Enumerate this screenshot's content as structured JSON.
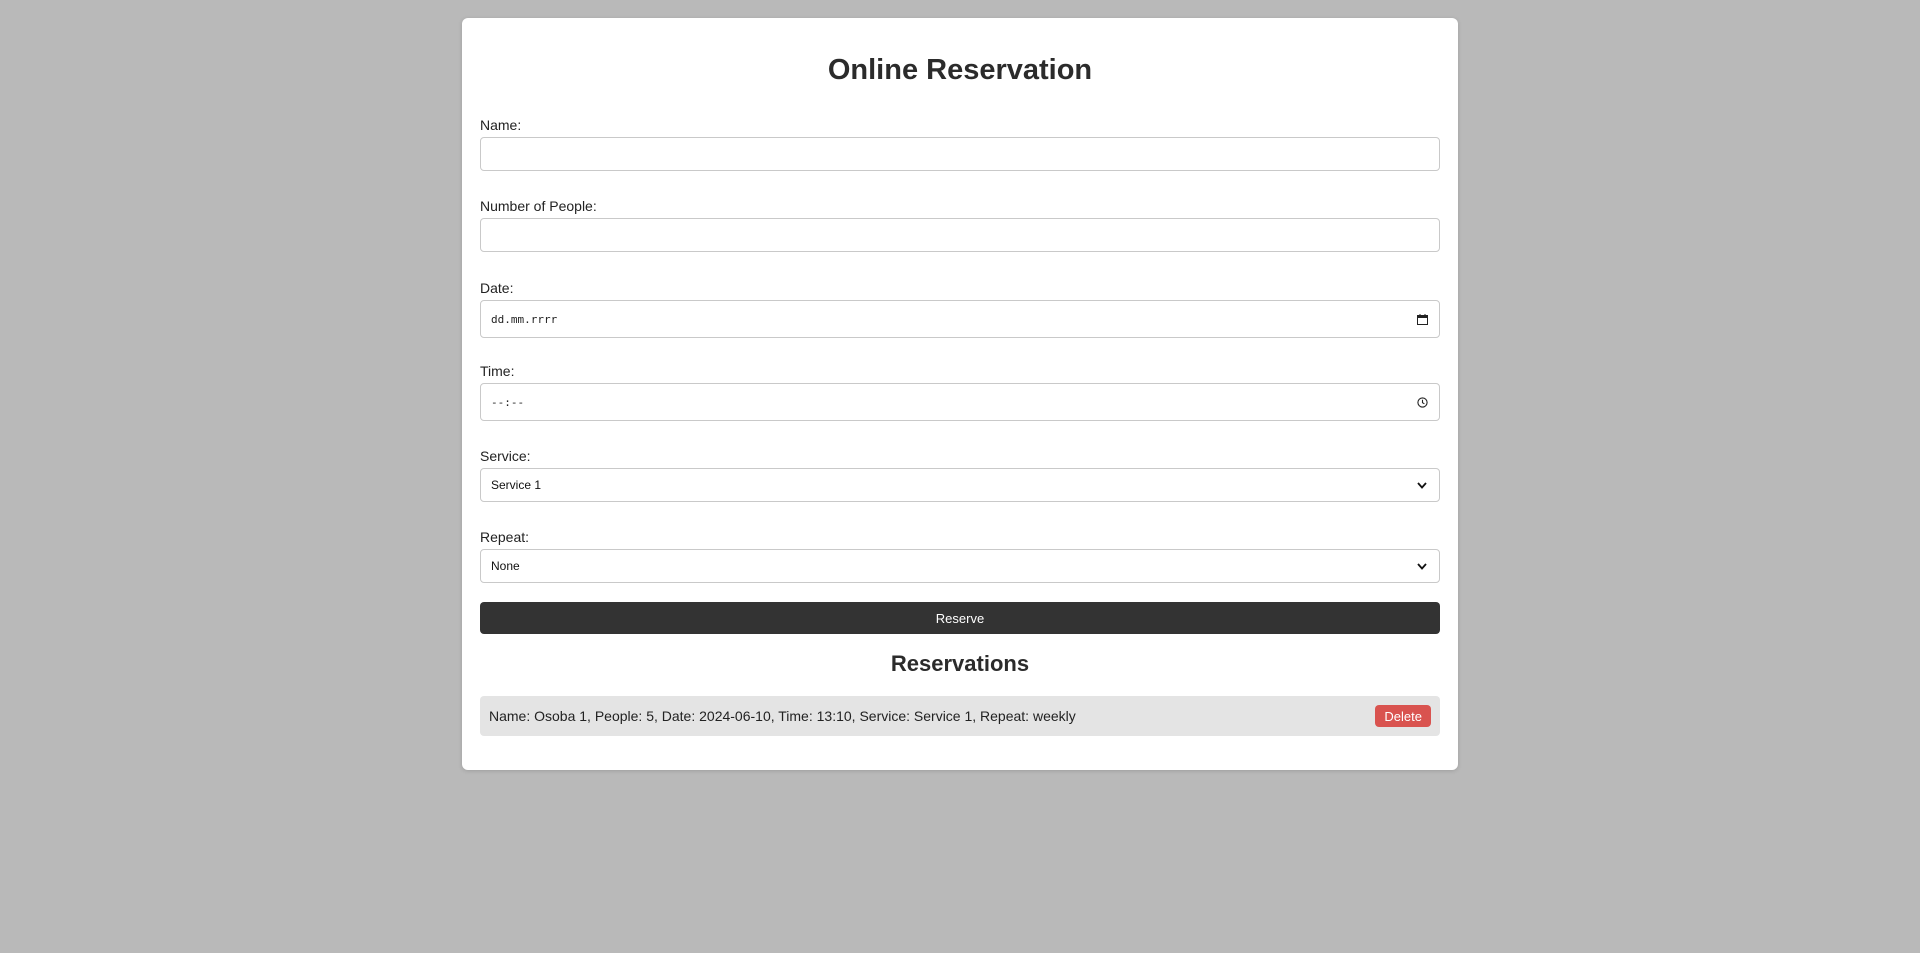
{
  "page": {
    "title": "Online Reservation"
  },
  "form": {
    "name": {
      "label": "Name:",
      "value": ""
    },
    "people": {
      "label": "Number of People:",
      "value": ""
    },
    "date": {
      "label": "Date:",
      "placeholder": "dd.mm.rrrr",
      "icon": "calendar-icon"
    },
    "time": {
      "label": "Time:",
      "placeholder": "--:--",
      "icon": "clock-icon"
    },
    "service": {
      "label": "Service:",
      "selected": "Service 1",
      "icon": "chevron-down-icon"
    },
    "repeat": {
      "label": "Repeat:",
      "selected": "None",
      "icon": "chevron-down-icon"
    },
    "submit_label": "Reserve"
  },
  "reservations": {
    "heading": "Reservations",
    "items": [
      {
        "text": "Name: Osoba 1, People: 5, Date: 2024-06-10, Time: 13:10, Service: Service 1, Repeat: weekly",
        "delete_label": "Delete"
      }
    ]
  },
  "colors": {
    "background": "#b9b9b9",
    "card": "#ffffff",
    "primary_button": "#333333",
    "delete_button": "#d9534f",
    "reservation_row": "#e4e4e4"
  }
}
